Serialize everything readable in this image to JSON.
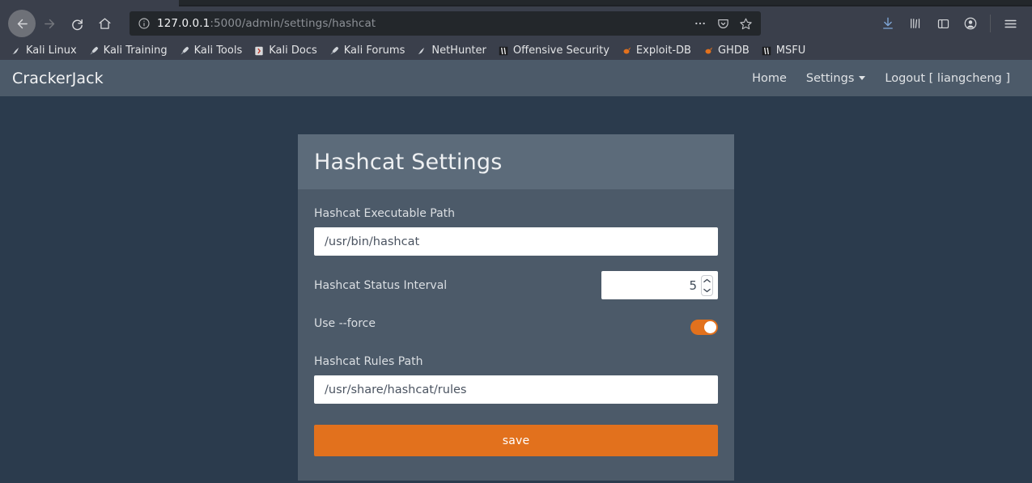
{
  "browser": {
    "nav": {
      "back": "back-arrow",
      "forward": "forward-arrow",
      "reload": "reload",
      "home": "home"
    },
    "url": {
      "host": "127.0.0.1",
      "rest": ":5000/admin/settings/hashcat",
      "info_icon": "info-icon"
    },
    "url_actions": [
      "page-actions-ellipsis",
      "pocket-icon",
      "bookmark-star-icon"
    ],
    "toolbar_right": [
      "downloads-icon",
      "library-icon",
      "sidebar-icon",
      "account-icon",
      "menu-icon"
    ],
    "bookmarks": [
      {
        "label": "Kali Linux",
        "icon": "kali-dragon-icon"
      },
      {
        "label": "Kali Training",
        "icon": "kali-tool-icon"
      },
      {
        "label": "Kali Tools",
        "icon": "kali-tool-icon"
      },
      {
        "label": "Kali Docs",
        "icon": "kali-docs-icon"
      },
      {
        "label": "Kali Forums",
        "icon": "kali-tool-icon"
      },
      {
        "label": "NetHunter",
        "icon": "kali-dragon-icon"
      },
      {
        "label": "Offensive Security",
        "icon": "offsec-icon"
      },
      {
        "label": "Exploit-DB",
        "icon": "exploitdb-icon"
      },
      {
        "label": "GHDB",
        "icon": "exploitdb-icon"
      },
      {
        "label": "MSFU",
        "icon": "offsec-icon"
      }
    ]
  },
  "app": {
    "brand": "CrackerJack",
    "nav_links": [
      {
        "label": "Home",
        "has_caret": false
      },
      {
        "label": "Settings",
        "has_caret": true
      },
      {
        "label": "Logout [ liangcheng ]",
        "has_caret": false
      }
    ]
  },
  "card": {
    "title": "Hashcat Settings",
    "fields": {
      "exec_path_label": "Hashcat Executable Path",
      "exec_path_value": "/usr/bin/hashcat",
      "status_interval_label": "Hashcat Status Interval",
      "status_interval_value": "5",
      "use_force_label": "Use --force",
      "use_force_state": "on",
      "rules_path_label": "Hashcat Rules Path",
      "rules_path_value": "/usr/share/hashcat/rules"
    },
    "save_label": "save"
  },
  "colors": {
    "page_bg": "#2b3b4d",
    "card_body": "#4c5a69",
    "card_header": "#5c6b7a",
    "accent": "#e2711d",
    "input_bg": "#ffffff",
    "browser_chrome": "#3a3f4b",
    "urlbar_bg": "#23272b"
  }
}
